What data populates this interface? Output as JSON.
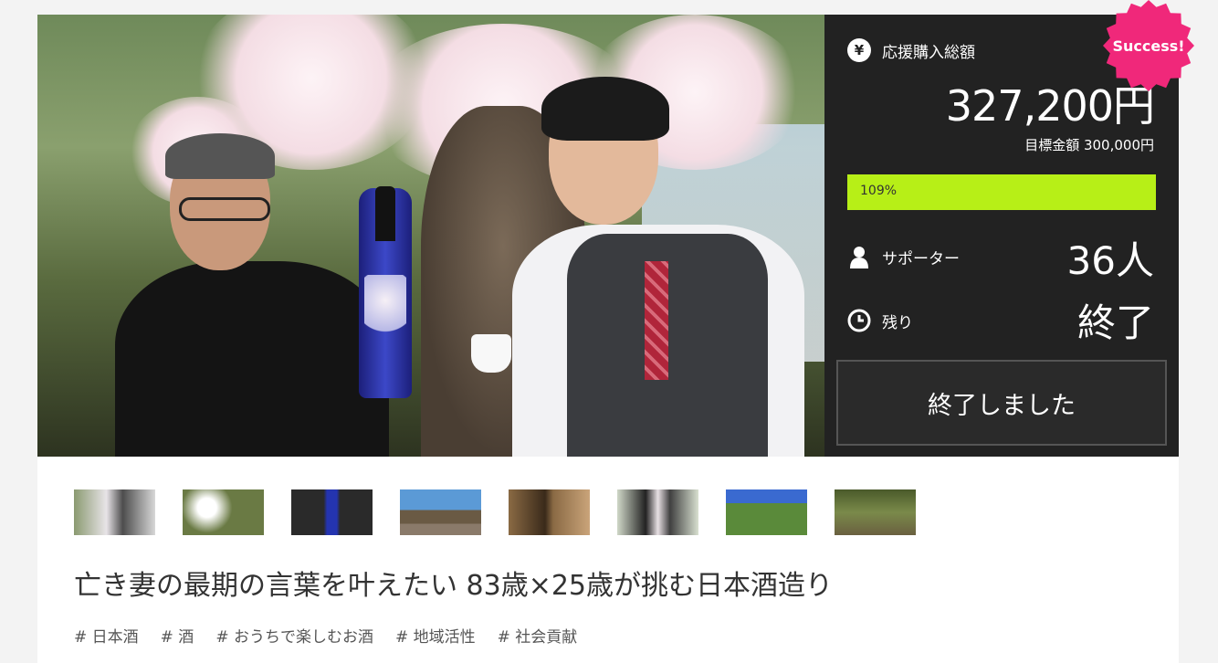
{
  "stats": {
    "total_label": "応援購入総額",
    "total_amount": "327,200円",
    "goal_text": "目標金額 300,000円",
    "progress_label": "109%",
    "progress_fraction": 1.0,
    "supporters_label": "サポーター",
    "supporters_value": "36人",
    "remaining_label": "残り",
    "remaining_value": "終了",
    "end_button": "終了しました",
    "badge": "Success!"
  },
  "colors": {
    "panel_bg": "#222222",
    "progress_fill": "#b7ef17",
    "badge": "#f0287a"
  },
  "icons": [
    "yen-icon",
    "person-icon",
    "clock-icon"
  ],
  "project": {
    "title": "亡き妻の最期の言葉を叶えたい 83歳×25歳が挑む日本酒造り"
  },
  "tags": [
    "# 日本酒",
    "# 酒",
    "# おうちで楽しむお酒",
    "# 地域活性",
    "# 社会貢献"
  ]
}
